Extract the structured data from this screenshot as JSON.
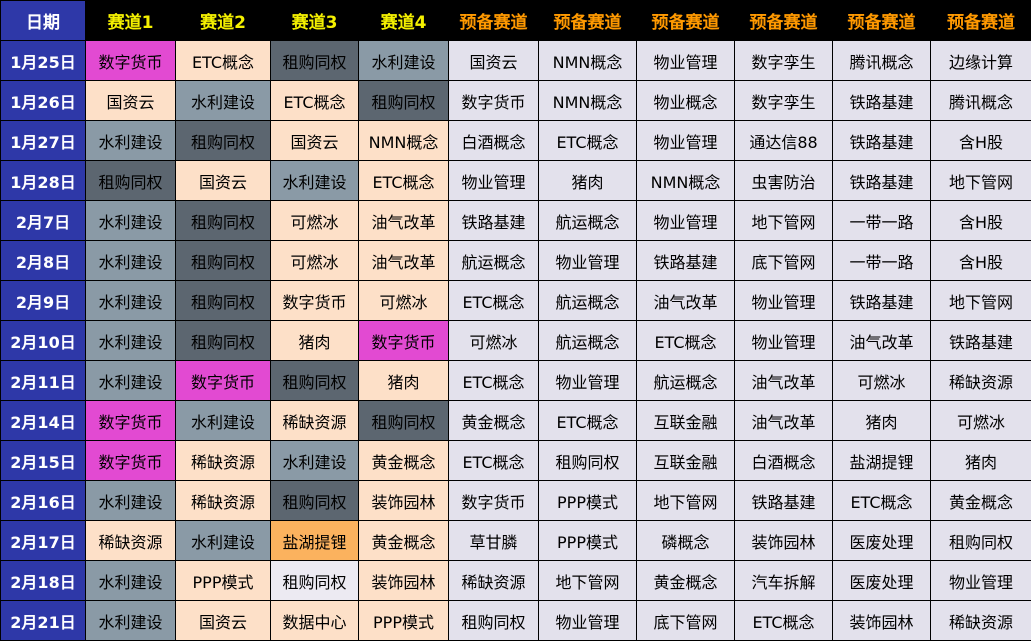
{
  "header": {
    "date": "日期",
    "tracks": [
      "赛道1",
      "赛道2",
      "赛道3",
      "赛道4"
    ],
    "reserves": [
      "预备赛道",
      "预备赛道",
      "预备赛道",
      "预备赛道",
      "预备赛道",
      "预备赛道"
    ]
  },
  "colors": {
    "header_bg": "#000000",
    "date_bg": "#2e38a8",
    "track_header_text": "#f4f000",
    "reserve_header_text": "#ff9900",
    "pink": "#e24ad2",
    "peach": "#fde0c8",
    "gray": "#8a9aa6",
    "dark": "#5c6670",
    "light": "#eceaf2",
    "orange": "#fbb25e",
    "reserve_bg": "#e3e1ec"
  },
  "rows": [
    {
      "date": "1月25日",
      "tracks": [
        [
          "数字货币",
          "pink"
        ],
        [
          "ETC概念",
          "peach"
        ],
        [
          "租购同权",
          "dark"
        ],
        [
          "水利建设",
          "gray"
        ]
      ],
      "reserves": [
        "国资云",
        "NMN概念",
        "物业管理",
        "数字孪生",
        "腾讯概念",
        "边缘计算"
      ]
    },
    {
      "date": "1月26日",
      "tracks": [
        [
          "国资云",
          "peach"
        ],
        [
          "水利建设",
          "gray"
        ],
        [
          "ETC概念",
          "peach"
        ],
        [
          "租购同权",
          "dark"
        ]
      ],
      "reserves": [
        "数字货币",
        "NMN概念",
        "物业概念",
        "数字孪生",
        "铁路基建",
        "腾讯概念"
      ]
    },
    {
      "date": "1月27日",
      "tracks": [
        [
          "水利建设",
          "gray"
        ],
        [
          "租购同权",
          "dark"
        ],
        [
          "国资云",
          "peach"
        ],
        [
          "NMN概念",
          "peach"
        ]
      ],
      "reserves": [
        "白酒概念",
        "ETC概念",
        "物业管理",
        "通达信88",
        "铁路基建",
        "含H股"
      ]
    },
    {
      "date": "1月28日",
      "tracks": [
        [
          "租购同权",
          "dark"
        ],
        [
          "国资云",
          "peach"
        ],
        [
          "水利建设",
          "gray"
        ],
        [
          "ETC概念",
          "peach"
        ]
      ],
      "reserves": [
        "物业管理",
        "猪肉",
        "NMN概念",
        "虫害防治",
        "铁路基建",
        "地下管网"
      ]
    },
    {
      "date": "2月7日",
      "tracks": [
        [
          "水利建设",
          "gray"
        ],
        [
          "租购同权",
          "dark"
        ],
        [
          "可燃冰",
          "peach"
        ],
        [
          "油气改革",
          "peach"
        ]
      ],
      "reserves": [
        "铁路基建",
        "航运概念",
        "物业管理",
        "地下管网",
        "一带一路",
        "含H股"
      ]
    },
    {
      "date": "2月8日",
      "tracks": [
        [
          "水利建设",
          "gray"
        ],
        [
          "租购同权",
          "dark"
        ],
        [
          "可燃冰",
          "peach"
        ],
        [
          "油气改革",
          "peach"
        ]
      ],
      "reserves": [
        "航运概念",
        "物业管理",
        "铁路基建",
        "底下管网",
        "一带一路",
        "含H股"
      ]
    },
    {
      "date": "2月9日",
      "tracks": [
        [
          "水利建设",
          "gray"
        ],
        [
          "租购同权",
          "dark"
        ],
        [
          "数字货币",
          "peach"
        ],
        [
          "可燃冰",
          "peach"
        ]
      ],
      "reserves": [
        "ETC概念",
        "航运概念",
        "油气改革",
        "物业管理",
        "铁路基建",
        "地下管网"
      ]
    },
    {
      "date": "2月10日",
      "tracks": [
        [
          "水利建设",
          "gray"
        ],
        [
          "租购同权",
          "dark"
        ],
        [
          "猪肉",
          "peach"
        ],
        [
          "数字货币",
          "pink"
        ]
      ],
      "reserves": [
        "可燃冰",
        "航运概念",
        "ETC概念",
        "物业管理",
        "油气改革",
        "铁路基建"
      ]
    },
    {
      "date": "2月11日",
      "tracks": [
        [
          "水利建设",
          "gray"
        ],
        [
          "数字货币",
          "pink"
        ],
        [
          "租购同权",
          "dark"
        ],
        [
          "猪肉",
          "peach"
        ]
      ],
      "reserves": [
        "ETC概念",
        "物业管理",
        "航运概念",
        "油气改革",
        "可燃冰",
        "稀缺资源"
      ]
    },
    {
      "date": "2月14日",
      "tracks": [
        [
          "数字货币",
          "pink"
        ],
        [
          "水利建设",
          "gray"
        ],
        [
          "稀缺资源",
          "peach"
        ],
        [
          "租购同权",
          "dark"
        ]
      ],
      "reserves": [
        "黄金概念",
        "ETC概念",
        "互联金融",
        "油气改革",
        "猪肉",
        "可燃冰"
      ]
    },
    {
      "date": "2月15日",
      "tracks": [
        [
          "数字货币",
          "pink"
        ],
        [
          "稀缺资源",
          "peach"
        ],
        [
          "水利建设",
          "gray"
        ],
        [
          "黄金概念",
          "peach"
        ]
      ],
      "reserves": [
        "ETC概念",
        "租购同权",
        "互联金融",
        "白酒概念",
        "盐湖提锂",
        "猪肉"
      ]
    },
    {
      "date": "2月16日",
      "tracks": [
        [
          "水利建设",
          "gray"
        ],
        [
          "稀缺资源",
          "peach"
        ],
        [
          "租购同权",
          "dark"
        ],
        [
          "装饰园林",
          "peach"
        ]
      ],
      "reserves": [
        "数字货币",
        "PPP模式",
        "地下管网",
        "铁路基建",
        "ETC概念",
        "黄金概念"
      ]
    },
    {
      "date": "2月17日",
      "tracks": [
        [
          "稀缺资源",
          "peach"
        ],
        [
          "水利建设",
          "gray"
        ],
        [
          "盐湖提锂",
          "orange"
        ],
        [
          "黄金概念",
          "peach"
        ]
      ],
      "reserves": [
        "草甘膦",
        "PPP模式",
        "磷概念",
        "装饰园林",
        "医废处理",
        "租购同权"
      ]
    },
    {
      "date": "2月18日",
      "tracks": [
        [
          "水利建设",
          "gray"
        ],
        [
          "PPP模式",
          "peach"
        ],
        [
          "租购同权",
          "light"
        ],
        [
          "装饰园林",
          "peach"
        ]
      ],
      "reserves": [
        "稀缺资源",
        "地下管网",
        "黄金概念",
        "汽车拆解",
        "医废处理",
        "物业管理"
      ]
    },
    {
      "date": "2月21日",
      "tracks": [
        [
          "水利建设",
          "gray"
        ],
        [
          "国资云",
          "peach"
        ],
        [
          "数据中心",
          "peach"
        ],
        [
          "PPP模式",
          "peach"
        ]
      ],
      "reserves": [
        "租购同权",
        "物业管理",
        "底下管网",
        "ETC概念",
        "装饰园林",
        "稀缺资源"
      ]
    }
  ]
}
